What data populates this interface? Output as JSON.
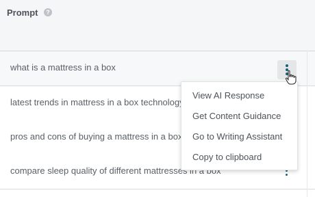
{
  "header": {
    "title": "Prompt",
    "help_icon": "help-circle-icon"
  },
  "rows": [
    {
      "text": "what is a mattress in a box"
    },
    {
      "text": "latest trends in mattress in a box technology"
    },
    {
      "text": "pros and cons of buying a mattress in a box"
    },
    {
      "text": "compare sleep quality of different mattresses in a box"
    }
  ],
  "row_actions_icon": "vertical-ellipsis-icon",
  "context_menu": {
    "items": [
      {
        "label": "View AI Response"
      },
      {
        "label": "Get Content Guidance"
      },
      {
        "label": "Go to Writing Assistant"
      },
      {
        "label": "Copy to clipboard"
      }
    ]
  },
  "colors": {
    "accent": "#17607a",
    "header_bg": "#f5f6f7"
  }
}
